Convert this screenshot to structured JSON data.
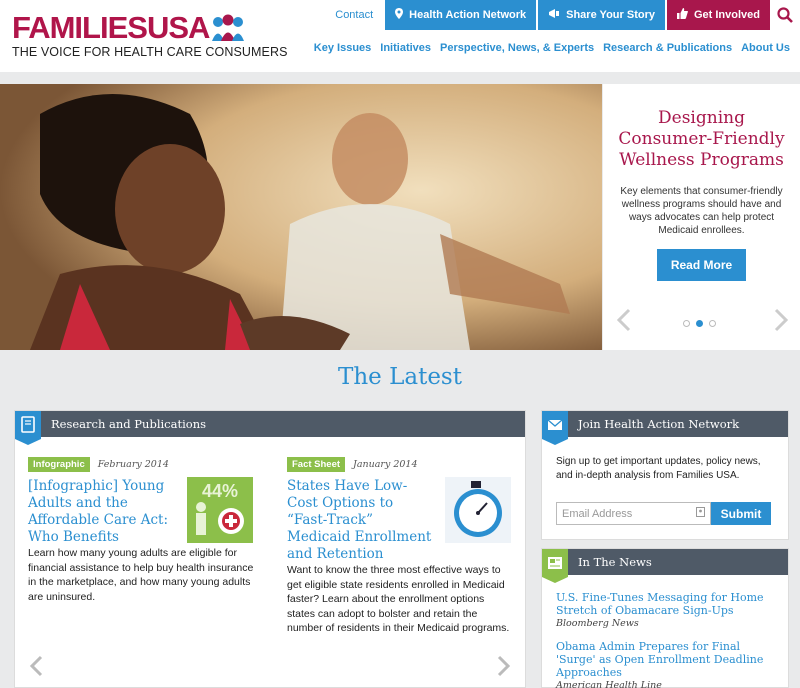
{
  "header": {
    "logo_families": "FAMILIES",
    "logo_usa": "USA",
    "tagline": "THE VOICE FOR HEALTH CARE CONSUMERS",
    "contact": "Contact",
    "health_action": "Health Action Network",
    "share_story": "Share Your Story",
    "get_involved": "Get Involved",
    "nav": [
      "Key Issues",
      "Initiatives",
      "Perspective, News, & Experts",
      "Research & Publications",
      "About Us"
    ],
    "colors": {
      "brand_red": "#a8174c",
      "brand_blue": "#2b8fd0"
    }
  },
  "hero": {
    "title": "Designing Consumer-Friendly Wellness Programs",
    "description": "Key elements that consumer-friendly wellness programs should have and ways advocates can help protect Medicaid enrollees.",
    "button": "Read More",
    "slides_total": 3,
    "active_slide": 2
  },
  "latest": {
    "title": "The Latest",
    "research": {
      "heading": "Research and Publications",
      "articles": [
        {
          "badge": "Infographic",
          "date": "February 2014",
          "title": "[Infographic] Young Adults and the Affordable Care Act: Who Benefits",
          "body": "Learn how many young adults are eligible for financial assistance to help buy health insurance in the marketplace, and how many young adults are uninsured.",
          "thumb_text": "44%",
          "thumb_icon": "young-adults-infographic-icon"
        },
        {
          "badge": "Fact Sheet",
          "date": "January 2014",
          "title": "States Have Low-Cost Options to “Fast-Track” Medicaid Enrollment and Retention",
          "body": "Want to know the three most effective ways to get eligible state residents enrolled in Medicaid faster? Learn about the enrollment options states can adopt to bolster and retain the number of residents in their Medicaid programs.",
          "thumb_icon": "stopwatch-icon"
        }
      ]
    },
    "join": {
      "heading": "Join Health Action Network",
      "text": "Sign up to get important updates, policy news, and in-depth analysis from Families USA.",
      "email_placeholder": "Email Address",
      "submit": "Submit"
    },
    "news": {
      "heading": "In The News",
      "items": [
        {
          "title": "U.S. Fine-Tunes Messaging for Home Stretch of Obamacare Sign-Ups",
          "source": "Bloomberg News"
        },
        {
          "title": "Obama Admin Prepares for Final 'Surge' as Open Enrollment Deadline Approaches",
          "source": "American Health Line"
        }
      ]
    }
  }
}
